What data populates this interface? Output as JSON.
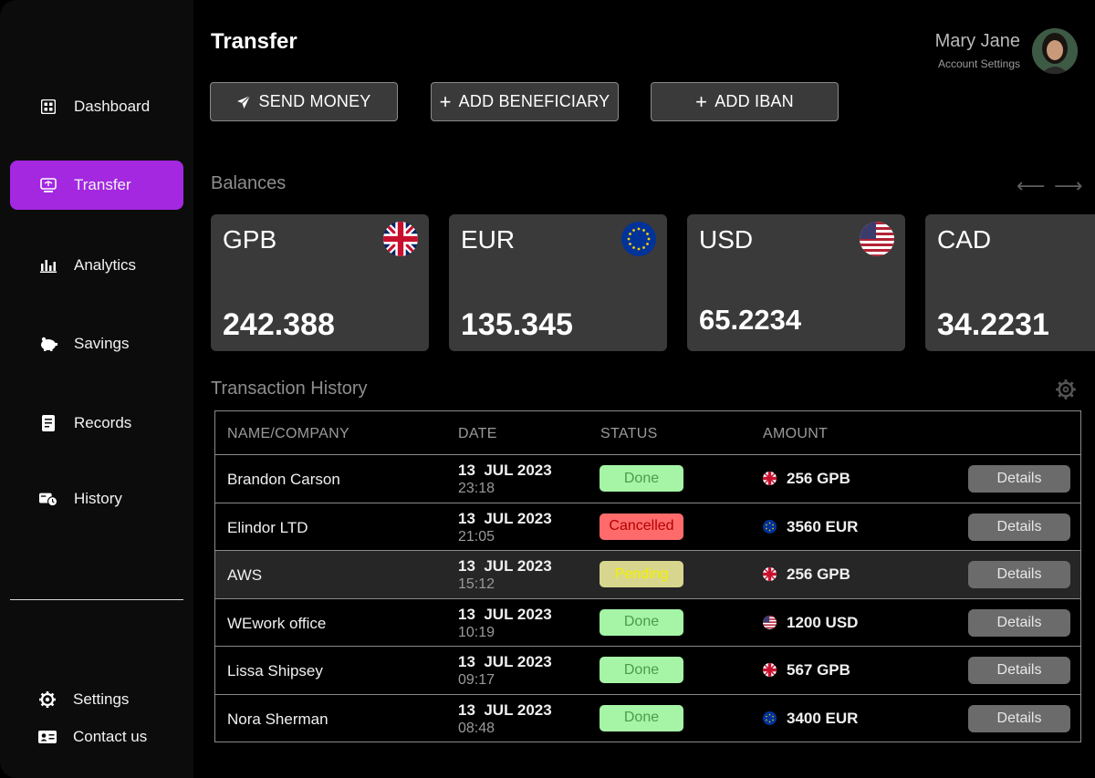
{
  "sidebar": {
    "items": [
      {
        "label": "Dashboard",
        "icon": "dashboard-icon"
      },
      {
        "label": "Transfer",
        "icon": "transfer-icon",
        "active": true
      },
      {
        "label": "Analytics",
        "icon": "analytics-icon"
      },
      {
        "label": "Savings",
        "icon": "piggy-bank-icon"
      },
      {
        "label": "Records",
        "icon": "records-icon"
      },
      {
        "label": "History",
        "icon": "history-icon"
      }
    ],
    "footer": [
      {
        "label": "Settings",
        "icon": "gear-icon"
      },
      {
        "label": "Contact us",
        "icon": "contact-card-icon"
      }
    ],
    "active_color": "#a328e0"
  },
  "header": {
    "title": "Transfer",
    "user_name": "Mary Jane",
    "user_subtitle": "Account Settings"
  },
  "actions": {
    "send_money": "SEND MONEY",
    "add_beneficiary": "ADD BENEFICIARY",
    "add_iban": "ADD IBAN"
  },
  "balances": {
    "title": "Balances",
    "prev_arrow": "⟵",
    "next_arrow": "⟶",
    "cards": [
      {
        "code": "GPB",
        "value": "242.388",
        "flag": "uk-flag-icon"
      },
      {
        "code": "EUR",
        "value": "135.345",
        "flag": "eu-flag-icon"
      },
      {
        "code": "USD",
        "value": "65.2234",
        "flag": "us-flag-icon"
      },
      {
        "code": "CAD",
        "value": "34.2231",
        "flag": "ca-flag-icon"
      }
    ]
  },
  "history": {
    "title": "Transaction History",
    "columns": [
      "NAME/COMPANY",
      "DATE",
      "STATUS",
      "AMOUNT"
    ],
    "details_label": "Details",
    "rows": [
      {
        "name": "Brandon Carson",
        "date": "13  JUL 2023",
        "time": "23:18",
        "status": "Done",
        "amount": "256 GPB",
        "flag": "uk"
      },
      {
        "name": "Elindor LTD",
        "date": "13  JUL 2023",
        "time": "21:05",
        "status": "Cancelled",
        "amount": "3560 EUR",
        "flag": "eu"
      },
      {
        "name": "AWS",
        "date": "13  JUL 2023",
        "time": "15:12",
        "status": "Pending",
        "amount": "256 GPB",
        "flag": "uk"
      },
      {
        "name": "WEwork office",
        "date": "13  JUL 2023",
        "time": "10:19",
        "status": "Done",
        "amount": "1200 USD",
        "flag": "us"
      },
      {
        "name": "Lissa Shipsey",
        "date": "13  JUL 2023",
        "time": "09:17",
        "status": "Done",
        "amount": "567 GPB",
        "flag": "uk"
      },
      {
        "name": "Nora Sherman",
        "date": "13  JUL 2023",
        "time": "08:48",
        "status": "Done",
        "amount": "3400 EUR",
        "flag": "eu"
      }
    ],
    "status_colors": {
      "Done": {
        "bg": "#a6f5a6",
        "fg": "#4c9a4c"
      },
      "Cancelled": {
        "bg": "#ff6b6b",
        "fg": "#b40000"
      },
      "Pending": {
        "bg": "#d8d68e",
        "fg": "#f2f000"
      }
    }
  }
}
